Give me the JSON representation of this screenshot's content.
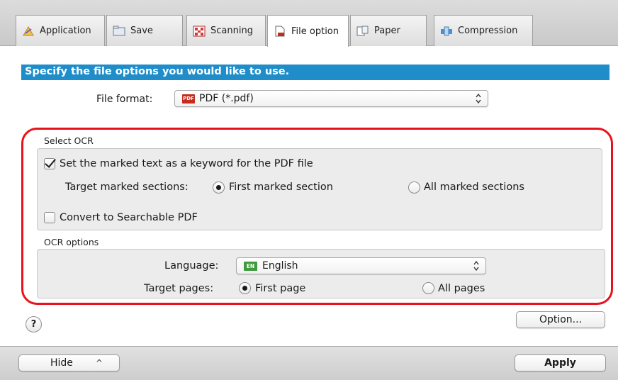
{
  "tabs": [
    {
      "label": "Application",
      "icon": "application-icon",
      "active": false
    },
    {
      "label": "Save",
      "icon": "folder-icon",
      "active": false
    },
    {
      "label": "Scanning",
      "icon": "scanning-icon",
      "active": false
    },
    {
      "label": "File option",
      "icon": "file-icon",
      "active": true
    },
    {
      "label": "Paper",
      "icon": "paper-icon",
      "active": false
    },
    {
      "label": "Compression",
      "icon": "compression-icon",
      "active": false
    }
  ],
  "header": {
    "title": "Specify the file options you would like to use."
  },
  "file_format": {
    "label": "File format:",
    "badge": "PDF",
    "value": "PDF (*.pdf)"
  },
  "select_ocr": {
    "title": "Select OCR",
    "keyword_checkbox": {
      "label": "Set the marked text as a keyword for the PDF file",
      "checked": true
    },
    "target_label": "Target marked sections:",
    "radio_first": {
      "label": "First marked section",
      "selected": true
    },
    "radio_all": {
      "label": "All marked sections",
      "selected": false
    },
    "searchable_checkbox": {
      "label": "Convert to Searchable PDF",
      "checked": false
    }
  },
  "ocr_options": {
    "title": "OCR options",
    "language_label": "Language:",
    "language_badge": "EN",
    "language_value": "English",
    "target_pages_label": "Target pages:",
    "radio_first_page": {
      "label": "First page",
      "selected": true
    },
    "radio_all_pages": {
      "label": "All pages",
      "selected": false
    }
  },
  "buttons": {
    "help": "?",
    "option": "Option...",
    "hide": "Hide",
    "hide_chevron": "^",
    "apply": "Apply"
  },
  "colors": {
    "header_bar": "#1f8dc9",
    "highlight_frame": "#e8121b",
    "pdf_badge": "#c62b1c",
    "en_badge": "#3e9a3e"
  }
}
